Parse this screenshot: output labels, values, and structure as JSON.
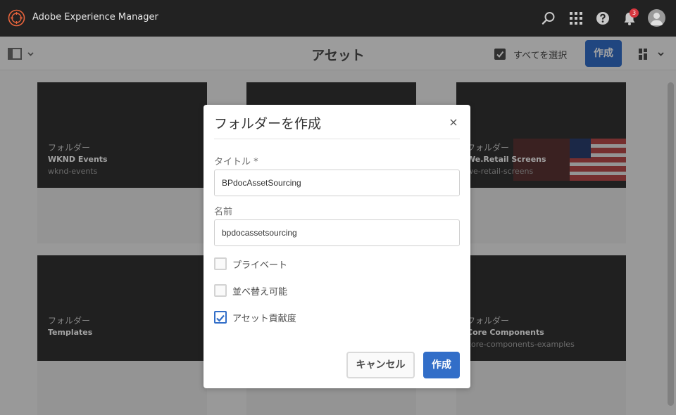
{
  "header": {
    "app_title": "Adobe Experience Manager",
    "icons": [
      "search-icon",
      "apps-grid-icon",
      "help-icon",
      "bell-icon",
      "user-avatar"
    ],
    "notification_count": "3"
  },
  "actionbar": {
    "page_title": "アセット",
    "select_all_label": "すべてを選択",
    "create_label": "作成"
  },
  "cards": [
    {
      "kind": "フォルダー",
      "name": "WKND Events",
      "path": "wknd-events"
    },
    {
      "kind": "",
      "name": "",
      "path": ""
    },
    {
      "kind": "フォルダー",
      "name": "We.Retail Screens",
      "path": "we-retail-screens"
    },
    {
      "kind": "フォルダー",
      "name": "Templates",
      "path": ""
    },
    {
      "kind": "",
      "name": "",
      "path": ""
    },
    {
      "kind": "フォルダー",
      "name": "Core Components",
      "path": "core-components-examples"
    }
  ],
  "dialog": {
    "title": "フォルダーを作成",
    "close_glyph": "×",
    "title_field_label": "タイトル *",
    "title_field_value": "BPdocAssetSourcing",
    "name_field_label": "名前",
    "name_field_value": "bpdocassetsourcing",
    "options": [
      {
        "label": "プライベート",
        "checked": false
      },
      {
        "label": "並べ替え可能",
        "checked": false
      },
      {
        "label": "アセット貢献度",
        "checked": true
      }
    ],
    "cancel_label": "キャンセル",
    "create_label": "作成"
  },
  "colors": {
    "header_bg": "#222222",
    "accent_blue": "#326ec8",
    "badge_red": "#d7373f",
    "card_dark": "#323232"
  }
}
